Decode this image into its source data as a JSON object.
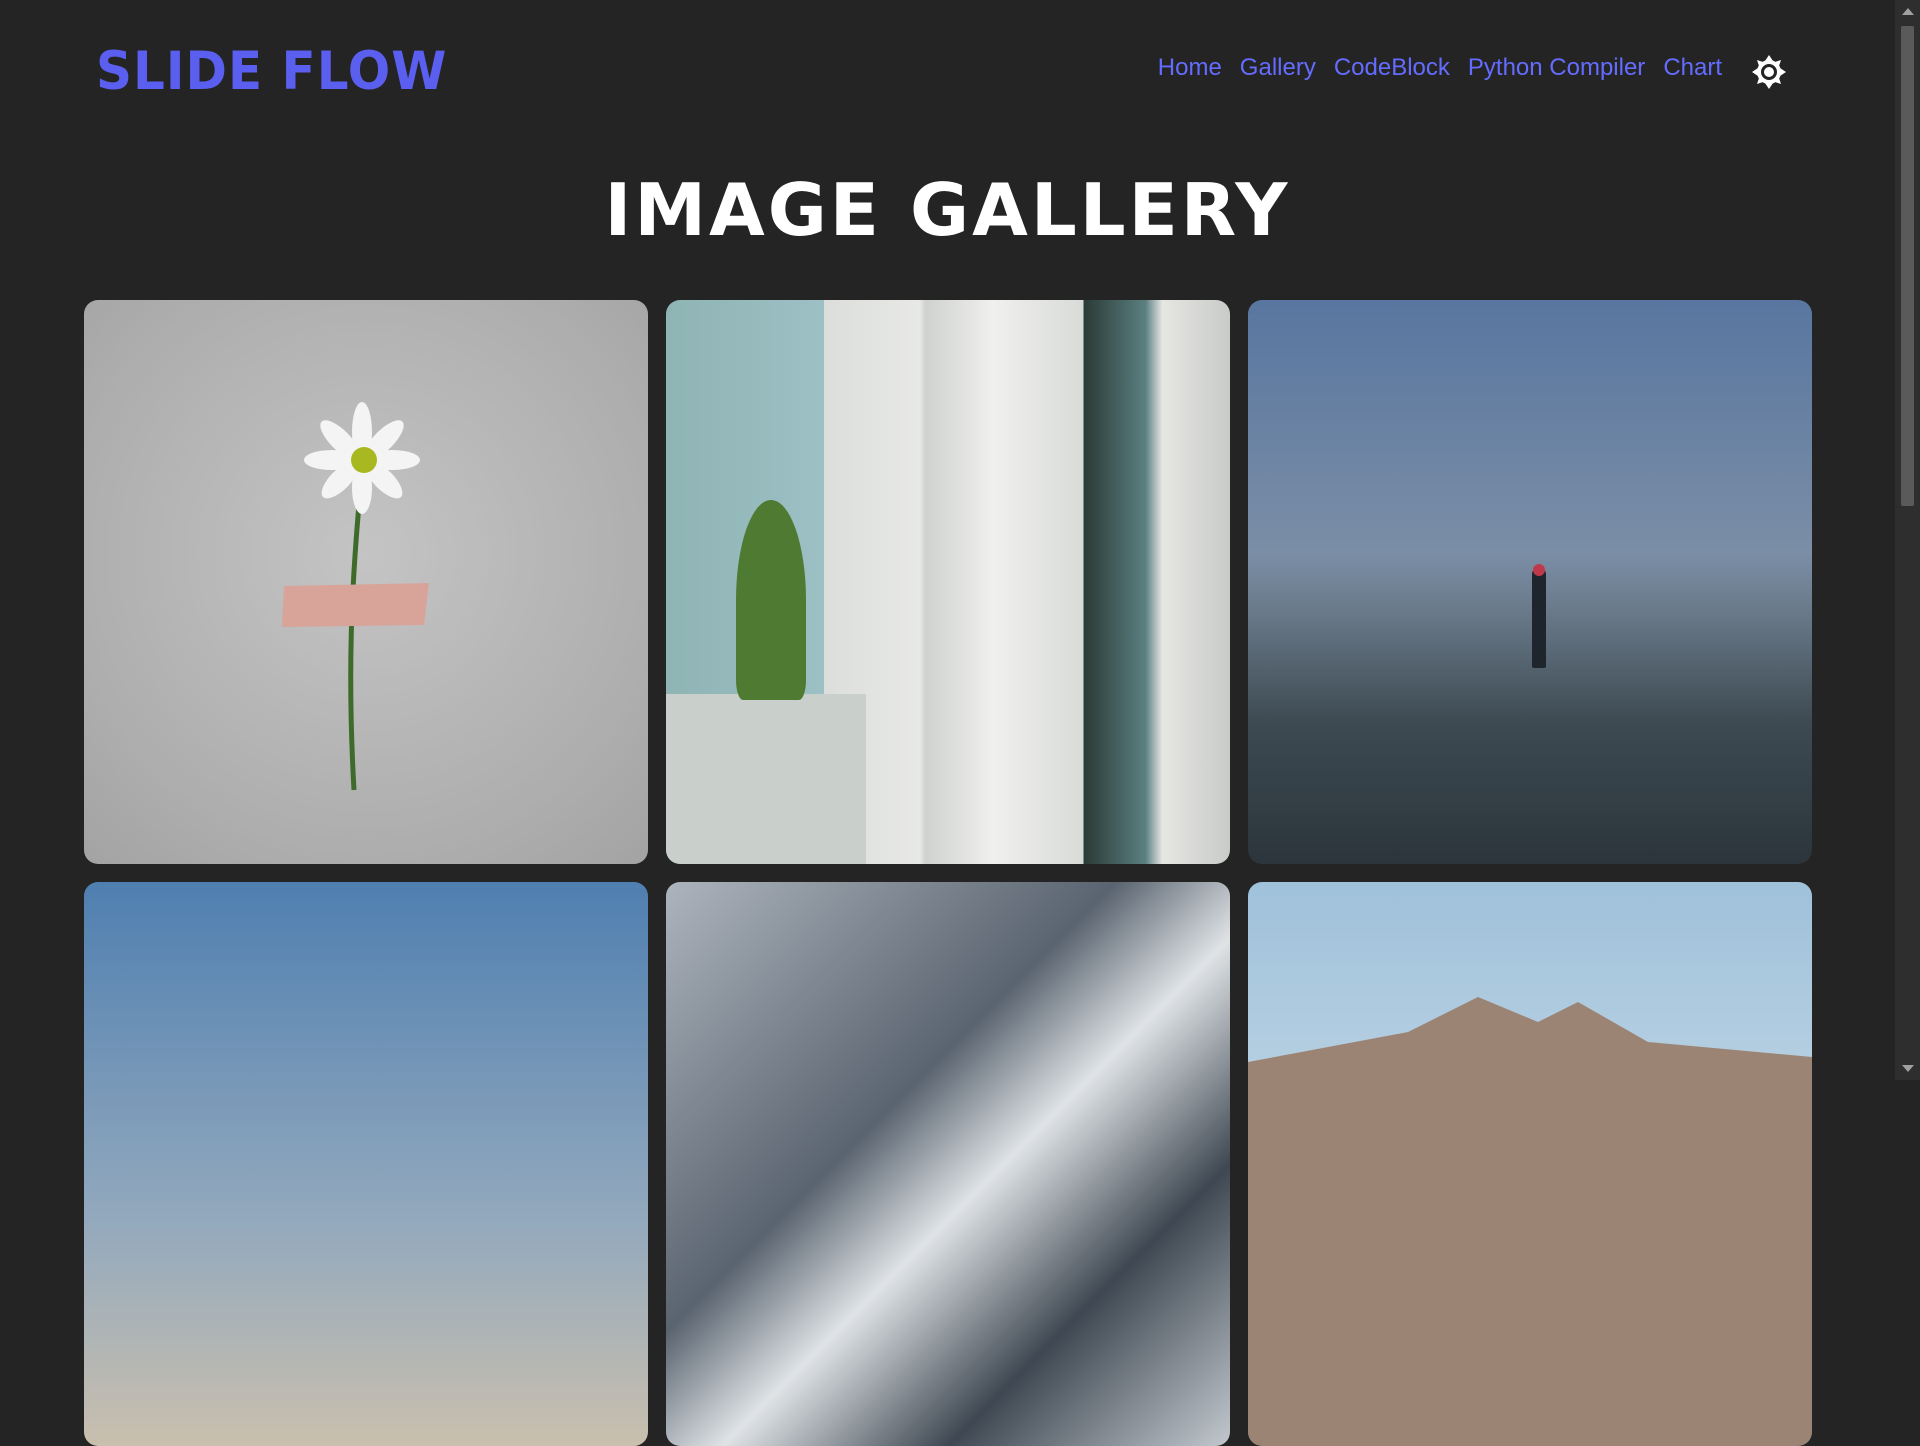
{
  "header": {
    "logo": "Slide Flow",
    "nav": [
      "Home",
      "Gallery",
      "CodeBlock",
      "Python Compiler",
      "Chart"
    ],
    "theme_toggle_icon": "sun-icon",
    "accent": "#646cff"
  },
  "main": {
    "title": "Image Gallery",
    "images": [
      {
        "subject": "daisy taped to gray wall"
      },
      {
        "subject": "white columns and glass building"
      },
      {
        "subject": "person in fog on beach"
      },
      {
        "subject": "blue sky"
      },
      {
        "subject": "snowy mountain peak"
      },
      {
        "subject": "distant mountain"
      }
    ]
  }
}
